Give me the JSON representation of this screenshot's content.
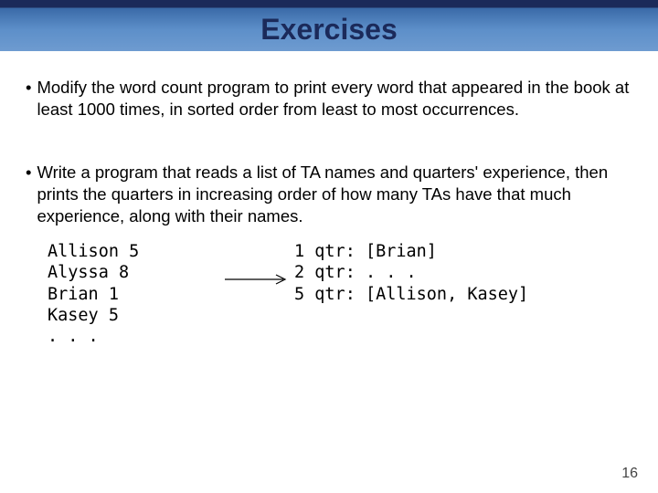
{
  "title": "Exercises",
  "bullets": [
    "Modify the word count program to print every word that appeared in the book at least 1000 times, in sorted order from least to most occurrences.",
    "Write a program that reads a list of TA names and quarters' experience, then prints the quarters in increasing order of how many TAs have that much experience, along with their names."
  ],
  "mono_left": "Allison 5\nAlyssa 8\nBrian 1\nKasey 5\n. . .",
  "mono_right": "1 qtr: [Brian]\n2 qtr: . . .\n5 qtr: [Allison, Kasey]",
  "page_number": "16"
}
